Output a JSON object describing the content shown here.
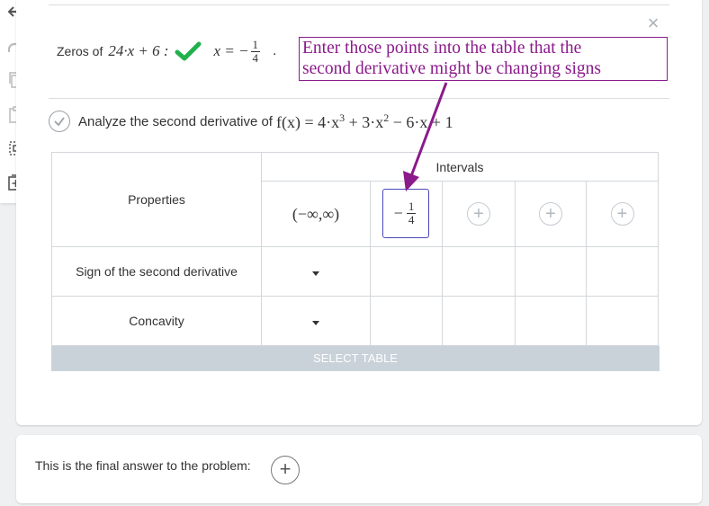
{
  "step": {
    "zeros_label": "Zeros of",
    "zeros_expr": "24·x + 6 :",
    "zero_lhs": "x = −",
    "zero_num": "1",
    "zero_den": "4",
    "trailing_dot": "."
  },
  "callout": {
    "line1": "Enter those points into the table that the",
    "line2": "second derivative might be changing signs"
  },
  "analyze": {
    "label": "Analyze the second derivative of",
    "expr_pre": "f(x) = 4·x",
    "exp1": "3",
    "mid": " + 3·x",
    "exp2": "2",
    "expr_post": " − 6·x + 1"
  },
  "table": {
    "intervals_header": "Intervals",
    "properties_header": "Properties",
    "interval1": "(−∞,∞)",
    "cell_sign": "−",
    "cell_num": "1",
    "cell_den": "4",
    "rows": [
      "Sign of the second derivative",
      "Concavity"
    ],
    "plus_glyph": "+",
    "select_table": "SELECT TABLE"
  },
  "final": {
    "label": "This is the final answer to the problem:",
    "plus_glyph": "+"
  },
  "close_glyph": "×",
  "colors": {
    "callout": "#8b1a8b",
    "check": "#22b14c",
    "selected_border": "#4a4ab8",
    "select_bar": "#c9d2d9"
  },
  "icons": [
    "undo-icon",
    "redo-icon",
    "copy-icon",
    "paste-icon",
    "select-icon",
    "add-box-icon",
    "check-mark-icon",
    "check-circle-icon"
  ]
}
